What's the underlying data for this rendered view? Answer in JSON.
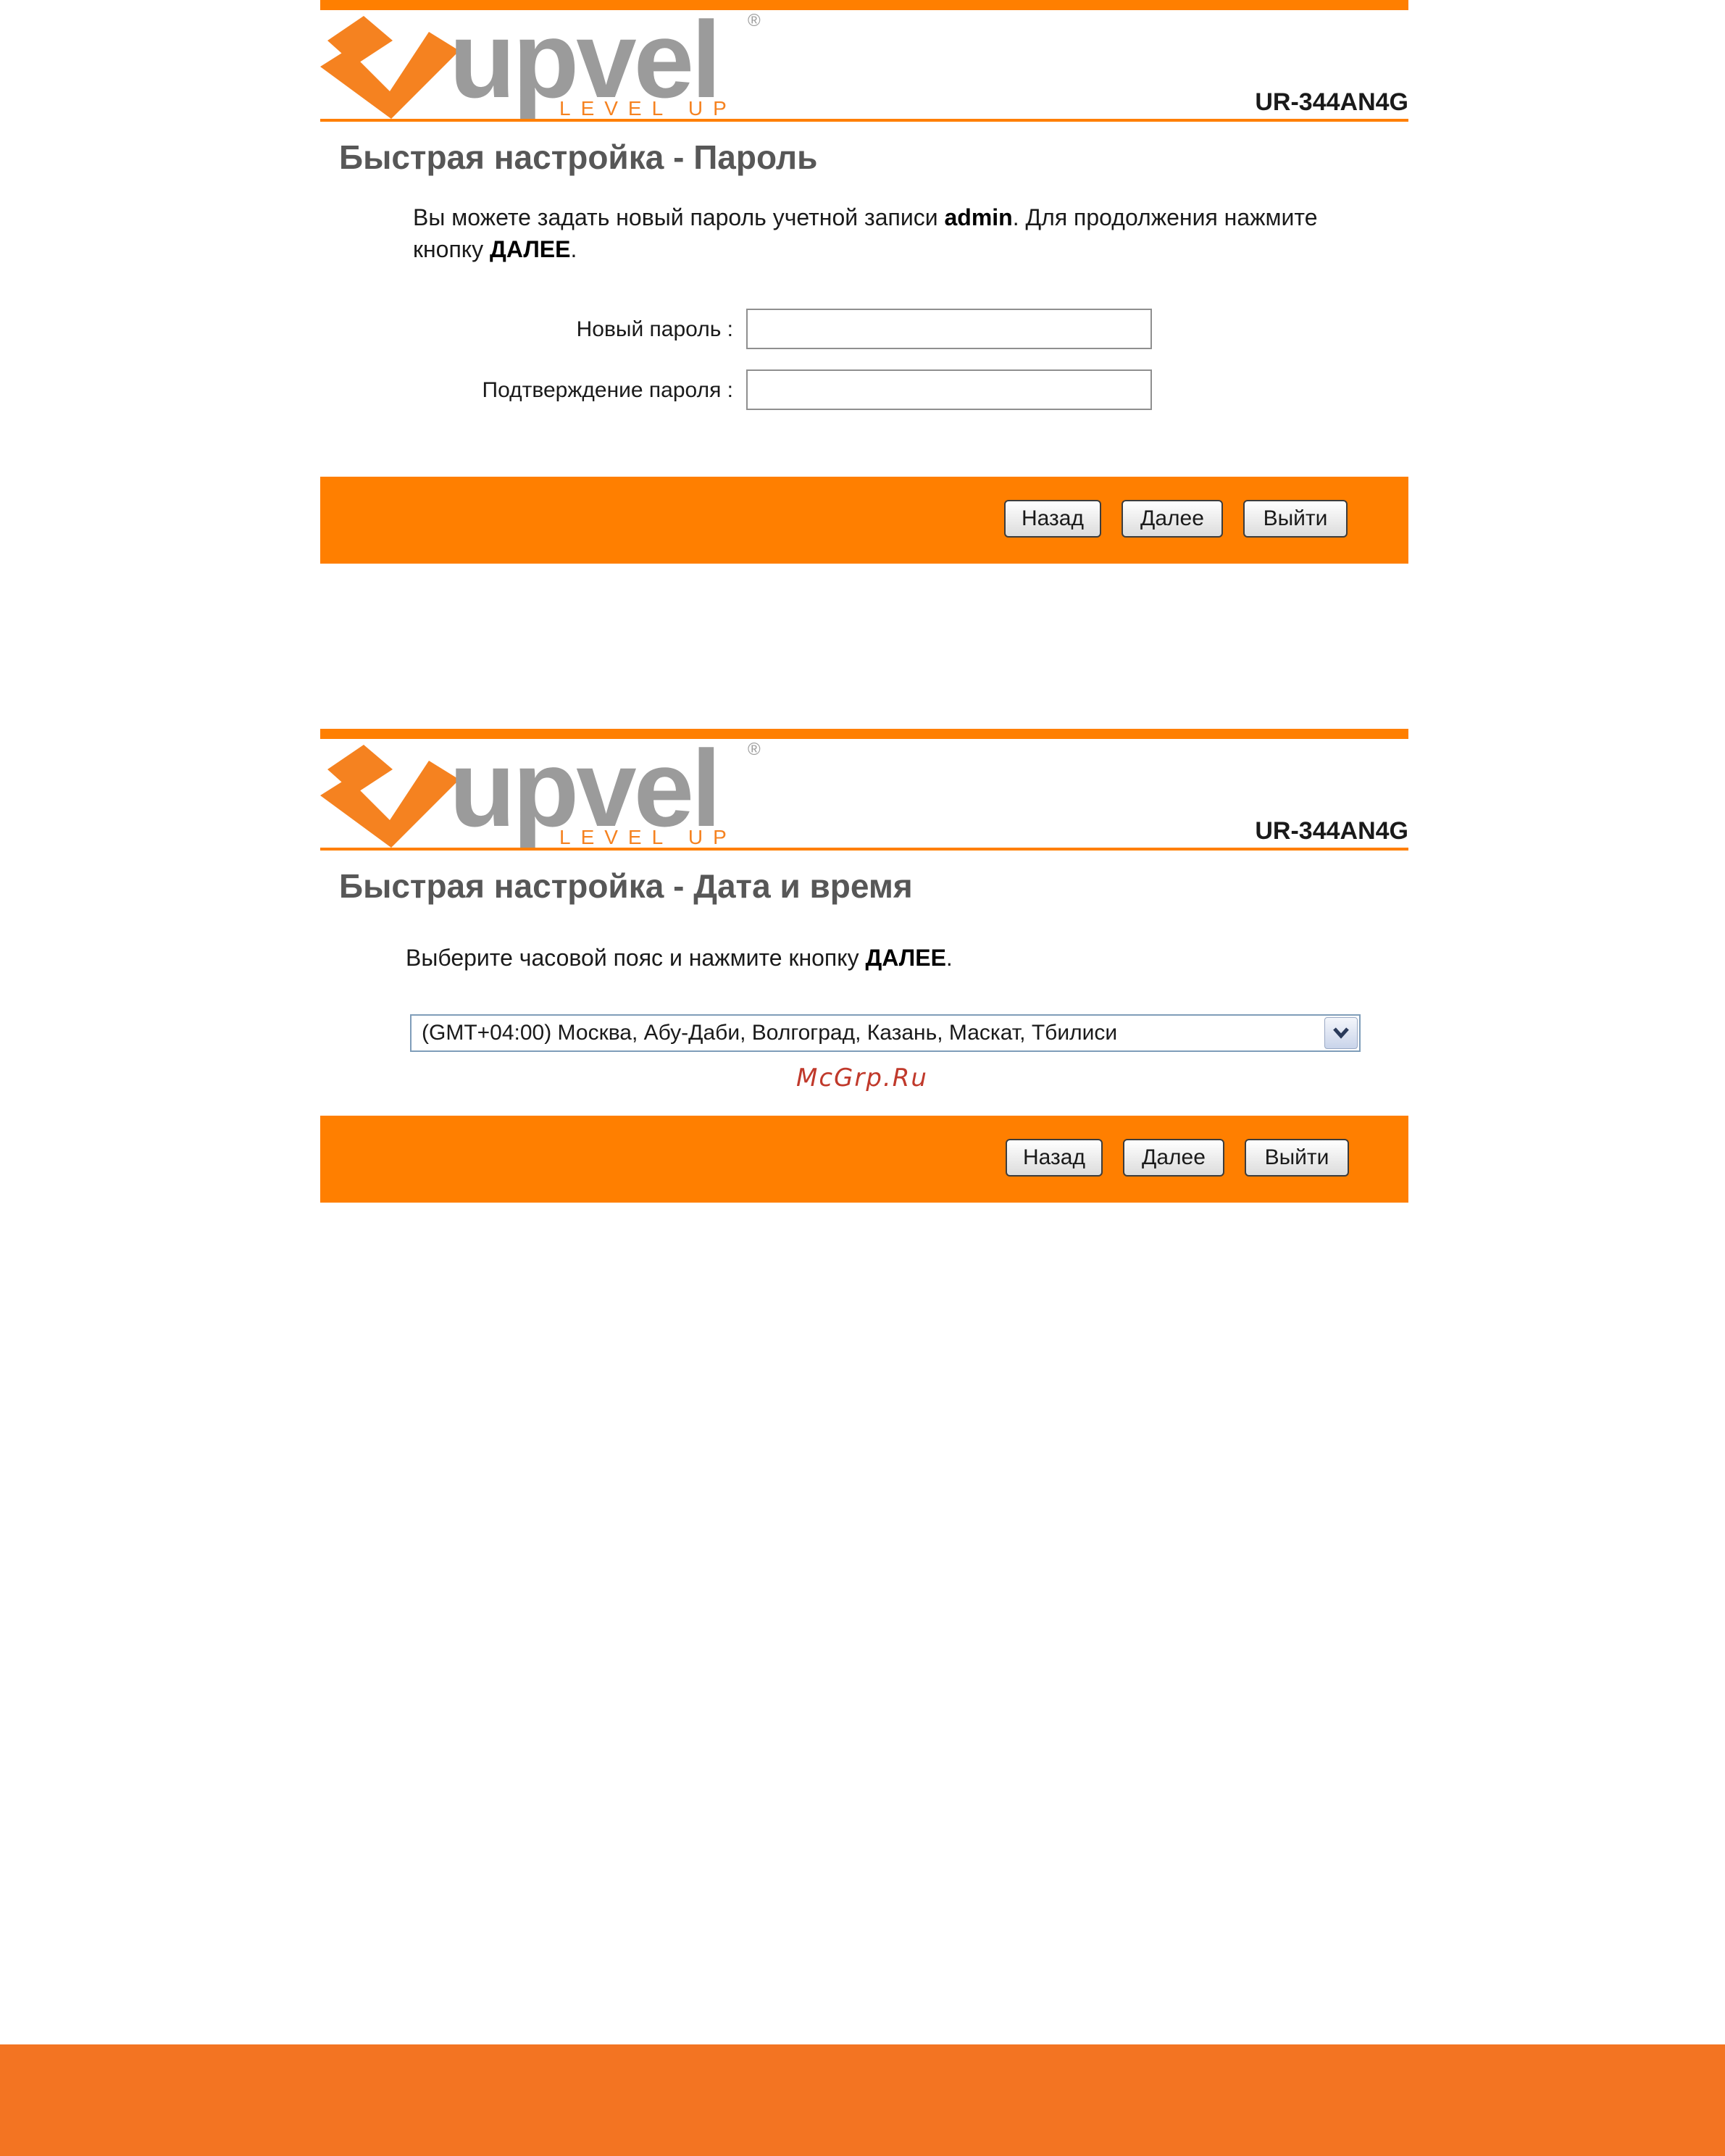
{
  "brand": {
    "logo_text": "upvel",
    "tagline": "LEVEL UP",
    "registered": "®",
    "accent_color": "#ff7f00",
    "footer_color": "#f37422"
  },
  "password_panel": {
    "model": "UR-344AN4G",
    "title": "Быстрая настройка - Пароль",
    "desc_part1": "Вы можете задать новый пароль учетной записи ",
    "desc_bold1": "admin",
    "desc_part2": ". Для продолжения нажмите",
    "desc_part3": "кнопку ",
    "desc_bold2": "ДАЛЕЕ",
    "desc_part4": ".",
    "new_password_label": "Новый пароль :",
    "new_password_value": "",
    "confirm_password_label": "Подтверждение пароля :",
    "confirm_password_value": "",
    "buttons": {
      "back": "Назад",
      "next": "Далее",
      "exit": "Выйти"
    }
  },
  "datetime_panel": {
    "model": "UR-344AN4G",
    "title": "Быстрая настройка - Дата и время",
    "desc_part1": "Выберите часовой пояс и нажмите кнопку ",
    "desc_bold": "ДАЛЕЕ",
    "desc_part2": ".",
    "timezone_selected": "(GMT+04:00) Москва, Абу-Даби, Волгоград, Казань, Маскат, Тбилиси",
    "timezone_icon": "chevron-down-icon",
    "buttons": {
      "back": "Назад",
      "next": "Далее",
      "exit": "Выйти"
    }
  },
  "watermark": "McGrp.Ru"
}
